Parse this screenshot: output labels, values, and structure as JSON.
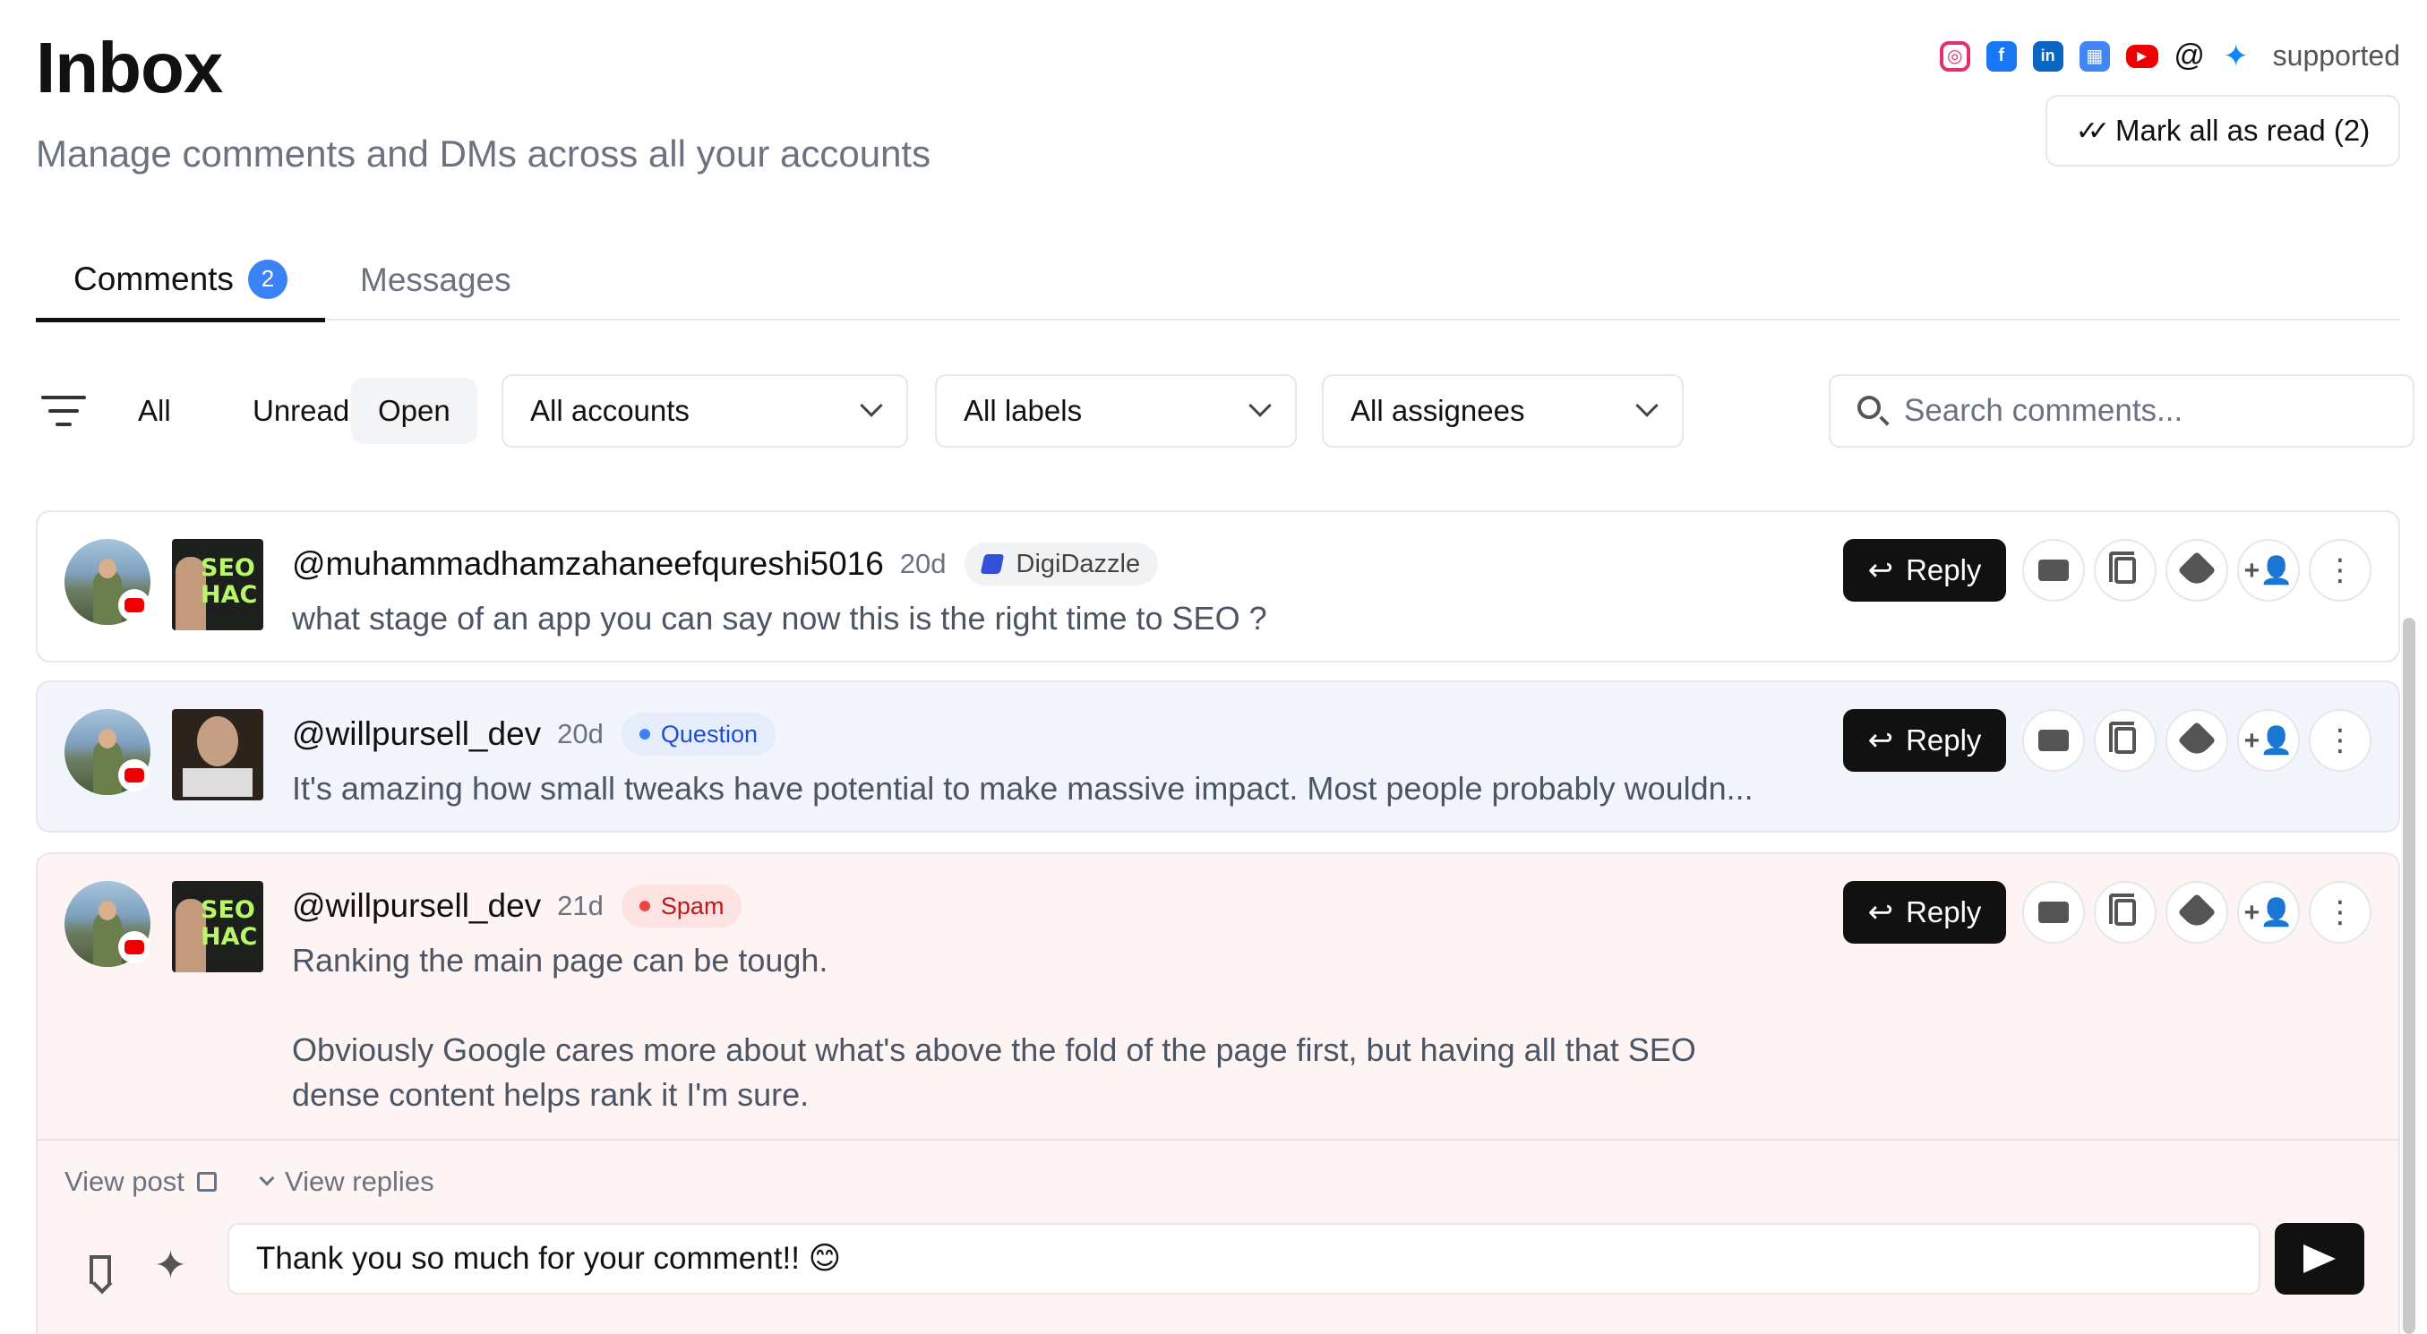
{
  "header": {
    "title": "Inbox",
    "subtitle": "Manage comments and DMs across all your accounts",
    "supported_label": "supported",
    "platform_icons": [
      "instagram-icon",
      "facebook-icon",
      "linkedin-icon",
      "google-business-icon",
      "youtube-icon",
      "threads-icon",
      "bluesky-icon"
    ],
    "mark_all_read_label": "Mark all as read (2)"
  },
  "tabs": [
    {
      "label": "Comments",
      "badge": "2",
      "active": true
    },
    {
      "label": "Messages",
      "active": false
    }
  ],
  "filters": {
    "chips": [
      "All",
      "Unread",
      "Open"
    ],
    "active_chip": "Open",
    "accounts": "All accounts",
    "labels": "All labels",
    "assignees": "All assignees",
    "search_placeholder": "Search comments..."
  },
  "comments": [
    {
      "handle": "@muhammadhamzahaneefqureshi5016",
      "age": "20d",
      "tag": "DigiDazzle",
      "text": "what stage of an app you can say now this is the right time to SEO ?",
      "thumb_text": "SEO HAC"
    },
    {
      "handle": "@willpursell_dev",
      "age": "20d",
      "tag": "Question",
      "text": "It's amazing how small tweaks have potential to make massive impact. Most people probably wouldn..."
    },
    {
      "handle": "@willpursell_dev",
      "age": "21d",
      "tag": "Spam",
      "text": "Ranking the main page can be tough.\n\nObviously Google cares more about what's above the fold of the page first, but having all that SEO\ndense content helps rank it I'm sure.",
      "thumb_text": "SEO HAC"
    }
  ],
  "actions": {
    "reply_label": "Reply"
  },
  "expanded": {
    "view_post": "View post",
    "view_replies": "View replies",
    "reply_draft": "Thank you so much for your comment!! 😊"
  },
  "colors": {
    "accent_blue": "#3b82f6",
    "question_tag": "#1d4ed8",
    "spam_tag": "#b91c1c",
    "card_question_bg": "#f2f6fc",
    "card_spam_bg": "#fdf4f3"
  }
}
